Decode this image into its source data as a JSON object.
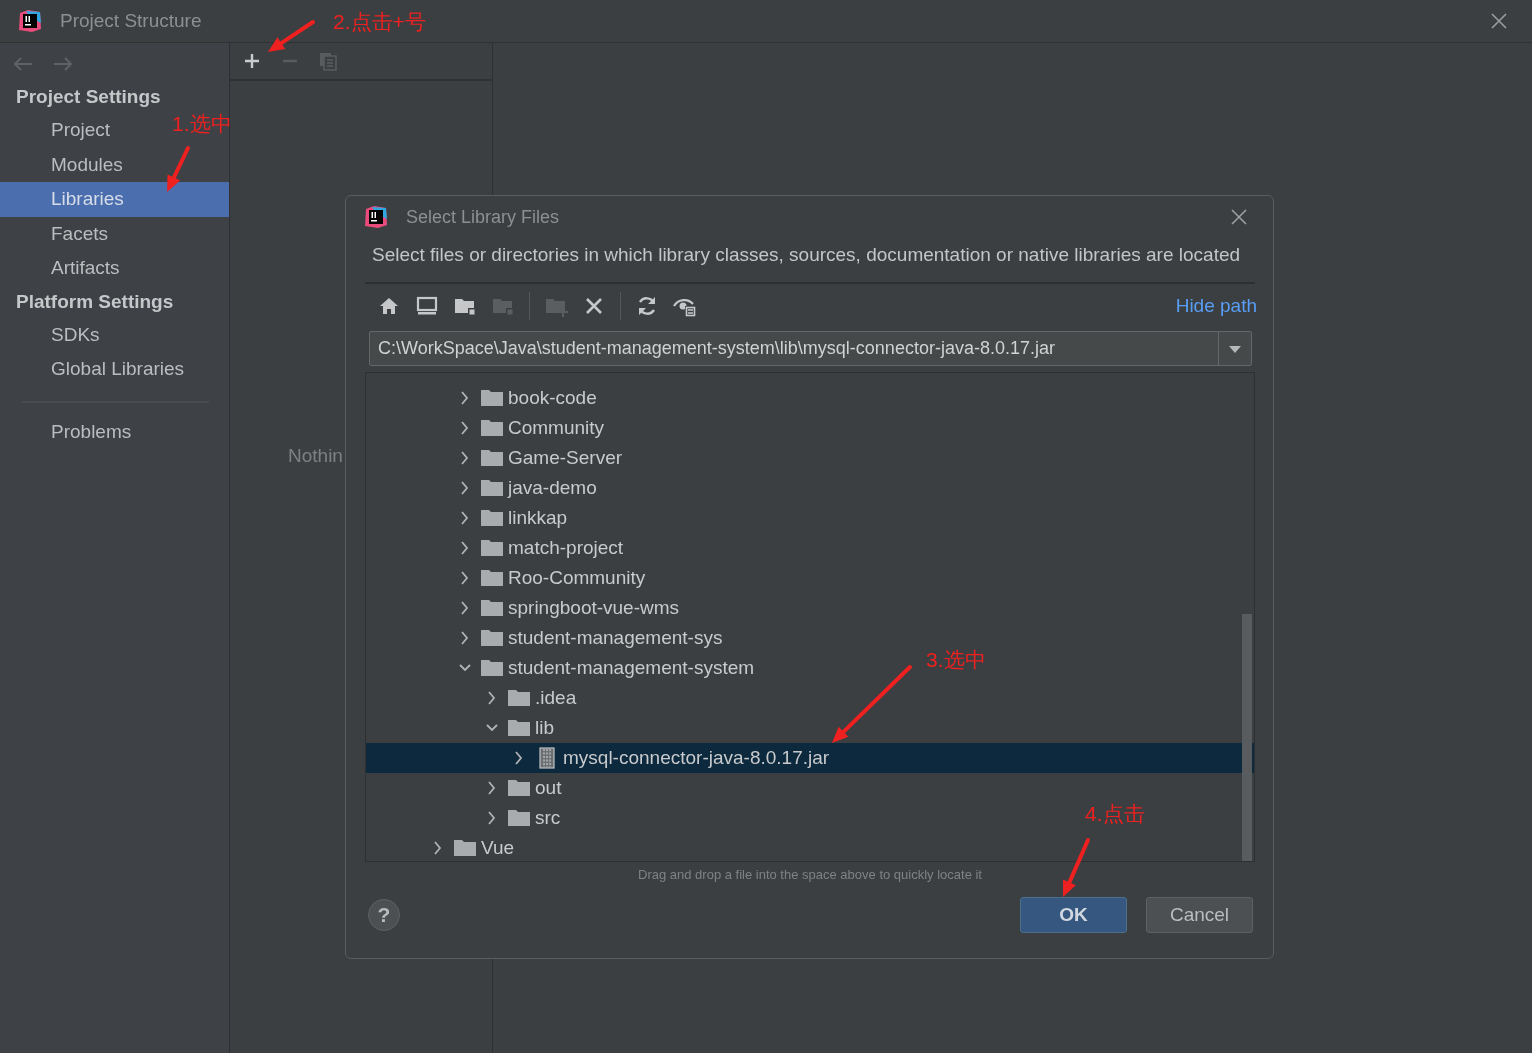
{
  "window": {
    "title": "Project Structure"
  },
  "sidebar": {
    "sections": [
      {
        "title": "Project Settings",
        "items": [
          {
            "label": "Project",
            "selected": false
          },
          {
            "label": "Modules",
            "selected": false
          },
          {
            "label": "Libraries",
            "selected": true
          },
          {
            "label": "Facets",
            "selected": false
          },
          {
            "label": "Artifacts",
            "selected": false
          }
        ]
      },
      {
        "title": "Platform Settings",
        "items": [
          {
            "label": "SDKs",
            "selected": false
          },
          {
            "label": "Global Libraries",
            "selected": false
          }
        ]
      },
      {
        "items": [
          {
            "label": "Problems",
            "selected": false
          }
        ]
      }
    ]
  },
  "library_panel": {
    "toolbar": [
      {
        "kind": "add",
        "disabled": false
      },
      {
        "kind": "remove",
        "disabled": true
      },
      {
        "kind": "copy",
        "disabled": true
      }
    ],
    "empty_text": "Nothin"
  },
  "dialog": {
    "title": "Select Library Files",
    "description": "Select files or directories in which library classes, sources, documentation or native libraries are located",
    "toolbar": [
      {
        "kind": "home",
        "disabled": false
      },
      {
        "kind": "desktop",
        "disabled": false
      },
      {
        "kind": "project-folder",
        "disabled": false
      },
      {
        "kind": "module-folder",
        "disabled": true
      },
      {
        "kind": "separator"
      },
      {
        "kind": "new-folder",
        "disabled": true
      },
      {
        "kind": "delete",
        "disabled": false
      },
      {
        "kind": "separator"
      },
      {
        "kind": "refresh",
        "disabled": false
      },
      {
        "kind": "show-hidden",
        "disabled": false
      }
    ],
    "hide_path_link": "Hide path",
    "path": "C:\\WorkSpace\\Java\\student-management-system\\lib\\mysql-connector-java-8.0.17.jar",
    "tree": [
      {
        "children": [
          {
            "label": "book-code",
            "kind": "folder",
            "expanded": false,
            "selected": false
          },
          {
            "label": "Community",
            "kind": "folder",
            "expanded": false,
            "selected": false
          },
          {
            "label": "Game-Server",
            "kind": "folder",
            "expanded": false,
            "selected": false
          },
          {
            "label": "java-demo",
            "kind": "folder",
            "expanded": false,
            "selected": false
          },
          {
            "label": "linkkap",
            "kind": "folder",
            "expanded": false,
            "selected": false
          },
          {
            "label": "match-project",
            "kind": "folder",
            "expanded": false,
            "selected": false
          },
          {
            "label": "Roo-Community",
            "kind": "folder",
            "expanded": false,
            "selected": false
          },
          {
            "label": "springboot-vue-wms",
            "kind": "folder",
            "expanded": false,
            "selected": false
          },
          {
            "label": "student-management-sys",
            "kind": "folder",
            "expanded": false,
            "selected": false
          },
          {
            "label": "student-management-system",
            "kind": "folder",
            "expanded": true,
            "selected": false,
            "children": [
              {
                "label": ".idea",
                "kind": "folder",
                "expanded": false,
                "selected": false
              },
              {
                "label": "lib",
                "kind": "folder",
                "expanded": true,
                "selected": false,
                "children": [
                  {
                    "label": "mysql-connector-java-8.0.17.jar",
                    "kind": "jar",
                    "expanded": false,
                    "selected": true
                  }
                ]
              },
              {
                "label": "out",
                "kind": "folder",
                "expanded": false,
                "selected": false
              },
              {
                "label": "src",
                "kind": "folder",
                "expanded": false,
                "selected": false
              }
            ]
          }
        ]
      },
      {
        "label": "Vue",
        "kind": "folder",
        "expanded": false,
        "selected": false
      }
    ],
    "hint": "Drag and drop a file into the space above to quickly locate it",
    "help": "?",
    "buttons": [
      {
        "label": "OK",
        "default": true
      },
      {
        "label": "Cancel",
        "default": false
      }
    ]
  },
  "annotations": [
    {
      "text": "1.选中"
    },
    {
      "text": "2.点击+号"
    },
    {
      "text": "3.选中"
    },
    {
      "text": "4.点击"
    }
  ]
}
